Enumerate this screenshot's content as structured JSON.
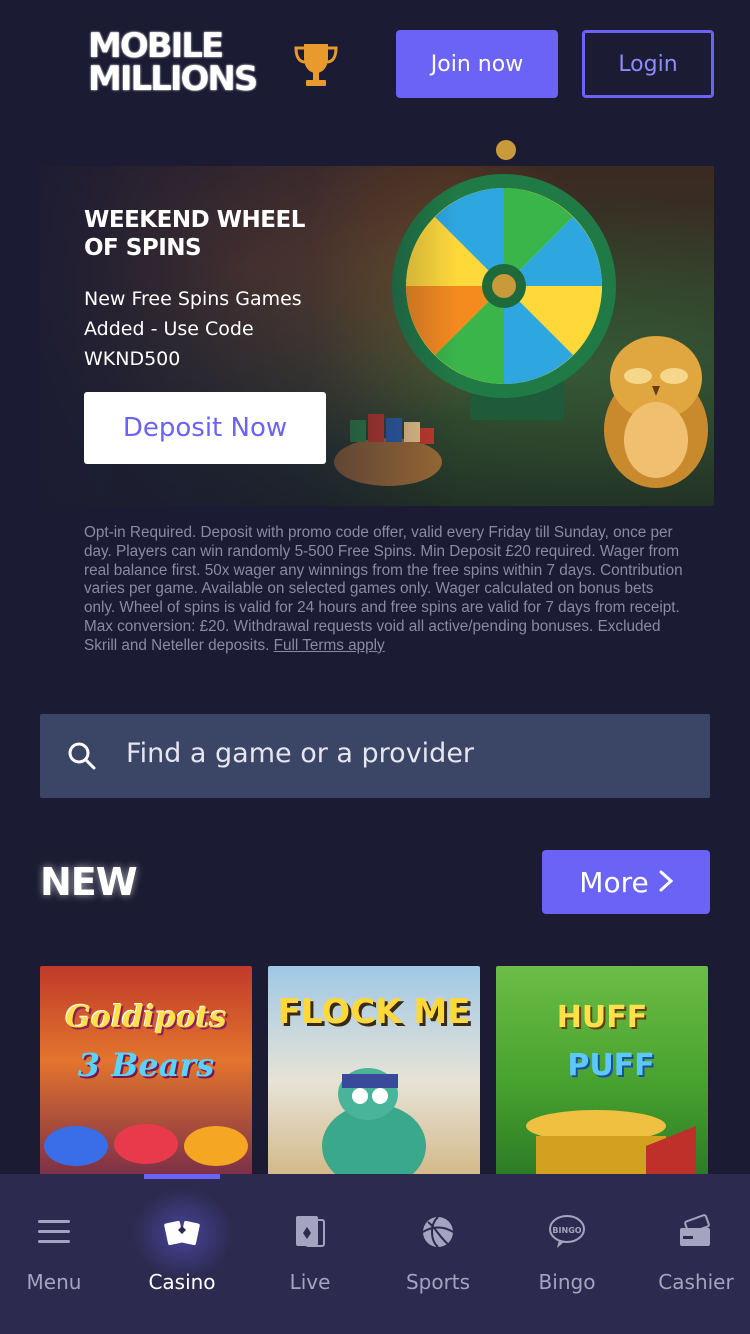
{
  "header": {
    "logo_line1": "MOBILE",
    "logo_line2": "MILLIONS",
    "trophy_icon": "trophy-icon",
    "join_label": "Join now",
    "login_label": "Login"
  },
  "promo": {
    "title": "WEEKEND WHEEL OF SPINS",
    "subtitle": "New Free Spins Games Added - Use Code WKND500",
    "cta_label": "Deposit Now"
  },
  "terms": {
    "text": "Opt-in Required. Deposit with promo code offer, valid every Friday till Sunday, once per day. Players can win randomly 5-500 Free Spins. Min Deposit £20 required. Wager from real balance first. 50x wager any winnings from the free spins within 7 days. Contribution varies per game. Available on selected games only. Wager calculated on bonus bets only. Wheel of spins is valid for 24 hours and free spins are valid for 7 days from receipt. Max conversion: £20. Withdrawal requests void all active/pending bonuses. Excluded Skrill and Neteller deposits.",
    "link_label": "Full Terms apply"
  },
  "search": {
    "placeholder": "Find a game or a provider"
  },
  "new_section": {
    "title": "NEW",
    "more_label": "More",
    "games": [
      {
        "title": "Goldipots",
        "subtitle": "3 Bears"
      },
      {
        "title": "FLOCK ME",
        "subtitle": ""
      },
      {
        "title": "HUFF",
        "subtitle": "PUFF"
      }
    ]
  },
  "bottom_nav": {
    "items": [
      {
        "label": "Menu",
        "icon": "menu-icon"
      },
      {
        "label": "Casino",
        "icon": "casino-icon"
      },
      {
        "label": "Live",
        "icon": "live-cards-icon"
      },
      {
        "label": "Sports",
        "icon": "sports-ball-icon"
      },
      {
        "label": "Bingo",
        "icon": "bingo-icon"
      },
      {
        "label": "Cashier",
        "icon": "cashier-icon"
      }
    ],
    "active": "Casino"
  },
  "colors": {
    "background": "#1b1b33",
    "accent": "#6a63f6",
    "search_bg": "#3b4565",
    "nav_bg": "#2c2a4e"
  }
}
